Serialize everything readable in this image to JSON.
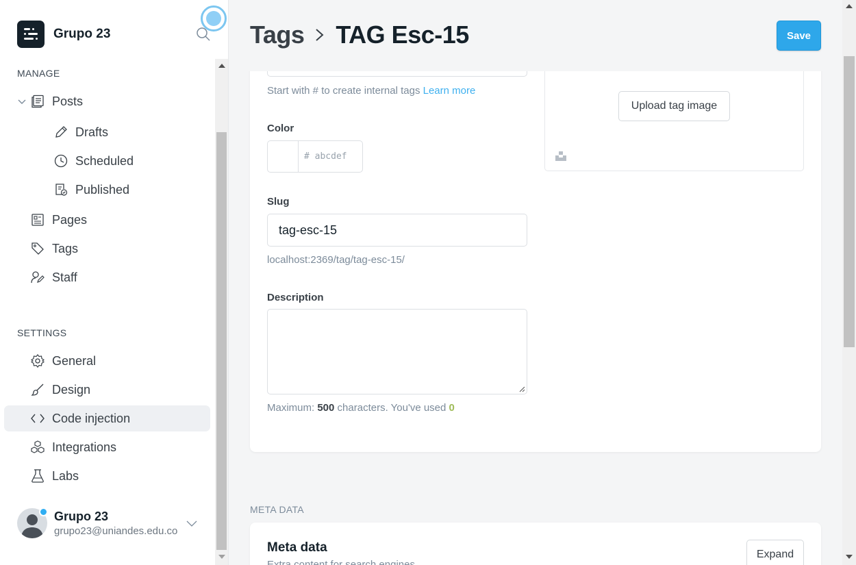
{
  "brand": {
    "name": "Grupo 23"
  },
  "sidebar": {
    "manage_title": "MANAGE",
    "settings_title": "SETTINGS",
    "posts": {
      "label": "Posts",
      "children": [
        {
          "label": "Drafts"
        },
        {
          "label": "Scheduled"
        },
        {
          "label": "Published"
        }
      ]
    },
    "pages": "Pages",
    "tags": "Tags",
    "staff": "Staff",
    "general": "General",
    "design": "Design",
    "code_injection": "Code injection",
    "integrations": "Integrations",
    "labs": "Labs"
  },
  "user": {
    "name": "Grupo 23",
    "email": "grupo23@uniandes.edu.co"
  },
  "header": {
    "parent": "Tags",
    "current": "TAG Esc-15",
    "save_label": "Save"
  },
  "form": {
    "name_hint": "Start with # to create internal tags",
    "learn_more": "Learn more",
    "color_label": "Color",
    "color_placeholder": "# abcdef",
    "slug_label": "Slug",
    "slug_value": "tag-esc-15",
    "slug_url": "localhost:2369/tag/tag-esc-15/",
    "description_label": "Description",
    "counter_prefix": "Maximum:",
    "counter_max": "500",
    "counter_mid": "characters. You've used",
    "counter_used": "0"
  },
  "image": {
    "upload_label": "Upload tag image"
  },
  "meta": {
    "section_title": "META DATA",
    "card_title": "Meta data",
    "card_subtitle": "Extra content for search engines",
    "expand_label": "Expand"
  },
  "colors": {
    "accent": "#2ea7ea",
    "link": "#3eb0ef",
    "ok": "#9fbb58",
    "active_bg": "#eef0f3"
  }
}
